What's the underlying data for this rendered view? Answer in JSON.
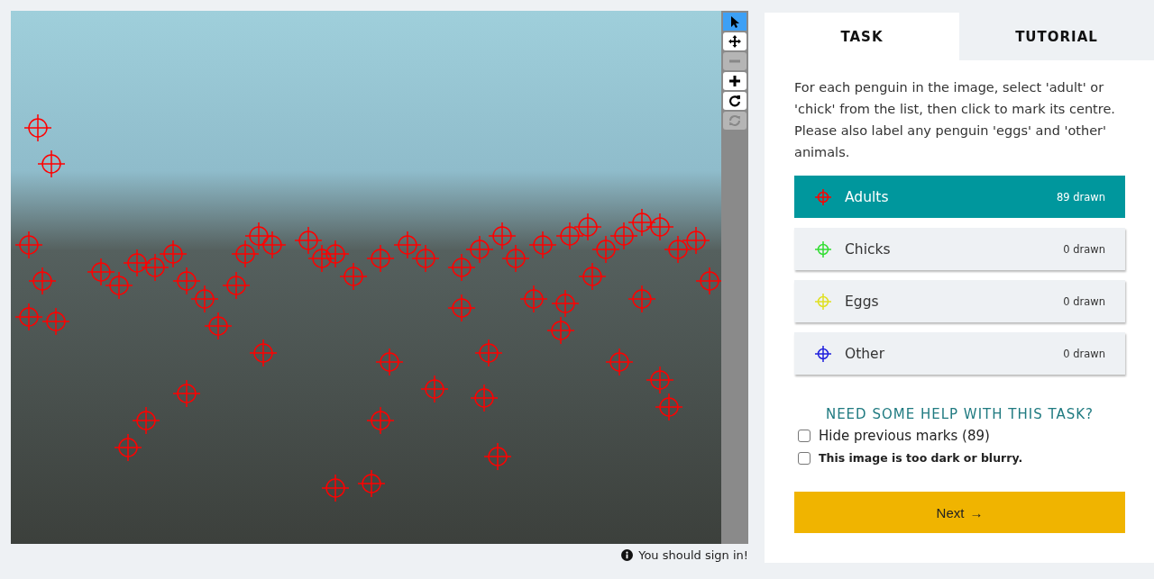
{
  "tools": [
    {
      "kind": "pointer",
      "selected": true,
      "disabled": false
    },
    {
      "kind": "move",
      "selected": false,
      "disabled": false
    },
    {
      "kind": "zoom-out",
      "selected": false,
      "disabled": true
    },
    {
      "kind": "zoom-in",
      "selected": false,
      "disabled": false
    },
    {
      "kind": "rotate",
      "selected": false,
      "disabled": false
    },
    {
      "kind": "reset",
      "selected": false,
      "disabled": true
    }
  ],
  "sign_in_notice": "You should sign in!",
  "tabs": [
    {
      "label": "TASK",
      "selected": true
    },
    {
      "label": "TUTORIAL",
      "selected": false
    }
  ],
  "instructions": "For each penguin in the image, select 'adult' or 'chick' from the list, then click to mark its centre. Please also label any penguin 'eggs' and 'other' animals.",
  "options": [
    {
      "label": "Adults",
      "count": "89 drawn",
      "color": "#ff0000",
      "selected": true
    },
    {
      "label": "Chicks",
      "count": "0 drawn",
      "color": "#33dd33",
      "selected": false
    },
    {
      "label": "Eggs",
      "count": "0 drawn",
      "color": "#e0e020",
      "selected": false
    },
    {
      "label": "Other",
      "count": "0 drawn",
      "color": "#2020dd",
      "selected": false
    }
  ],
  "help_link": "NEED SOME HELP WITH THIS TASK?",
  "checkboxes": [
    {
      "kind": "plain",
      "label": "Hide previous marks (89)",
      "checked": false
    },
    {
      "kind": "strong",
      "label": "This image is too dark or blurry.",
      "checked": false
    }
  ],
  "next_button": {
    "label": "Next",
    "arrow": "→"
  }
}
